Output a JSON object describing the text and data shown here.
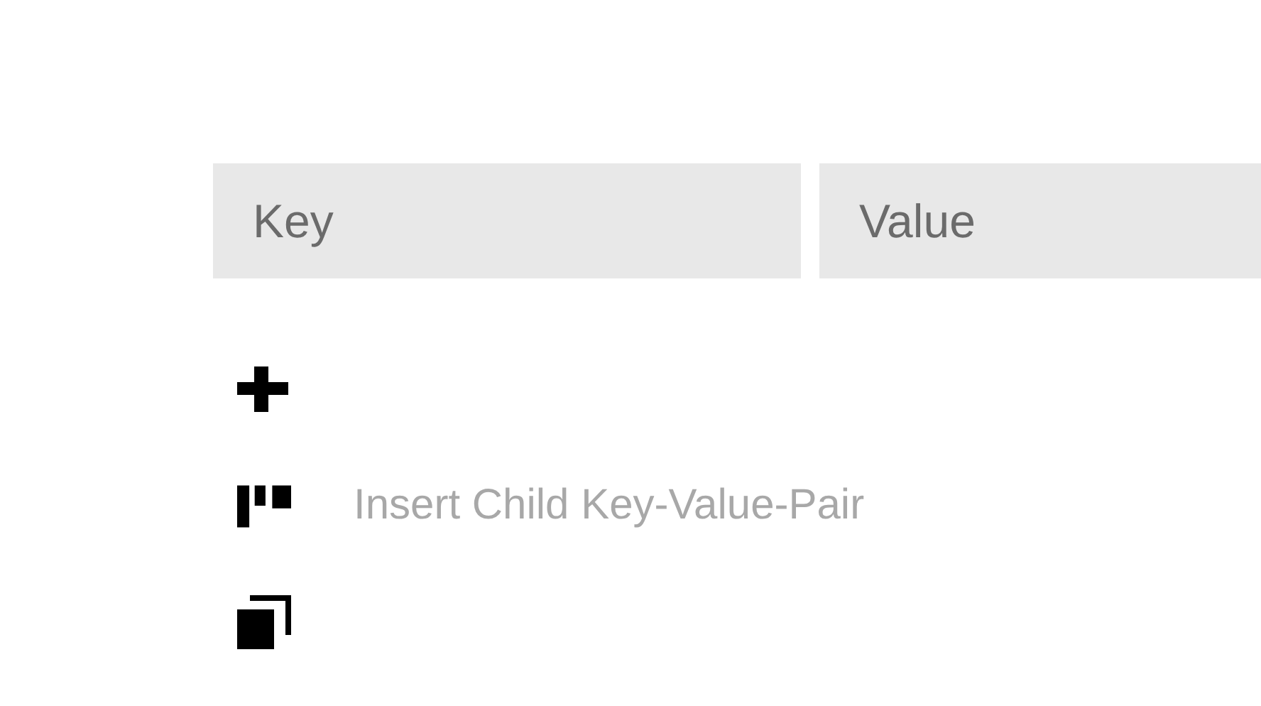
{
  "fields": [
    {
      "placeholder": "Key"
    },
    {
      "placeholder": "Value"
    }
  ],
  "actions": [
    {
      "kind": "add"
    },
    {
      "kind": "insert-child",
      "label": "Insert Child Key-Value-Pair"
    },
    {
      "kind": "duplicate"
    }
  ]
}
